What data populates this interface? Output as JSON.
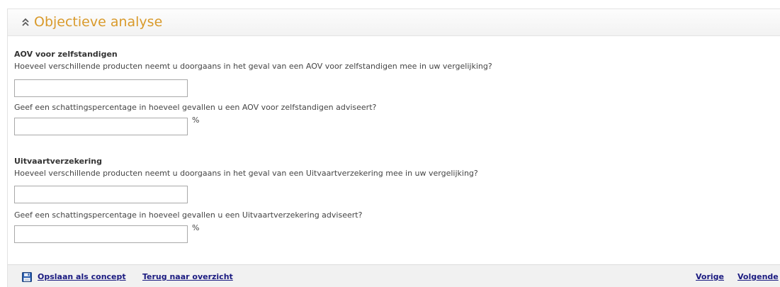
{
  "header": {
    "title": "Objectieve analyse",
    "collapse_icon": "chevron-double-up-icon"
  },
  "sections": [
    {
      "title": "AOV voor zelfstandigen",
      "q1": "Hoeveel verschillende producten neemt u doorgaans in het geval van een AOV voor zelfstandigen mee in uw vergelijking?",
      "q1_value": "",
      "q2": "Geef een schattingspercentage in hoeveel gevallen u een AOV voor zelfstandigen adviseert?",
      "q2_value": "",
      "q2_unit": "%"
    },
    {
      "title": "Uitvaartverzekering",
      "q1": "Hoeveel verschillende producten neemt u doorgaans in het geval van een Uitvaartverzekering mee in uw vergelijking?",
      "q1_value": "",
      "q2": "Geef een schattingspercentage in hoeveel gevallen u een Uitvaartverzekering adviseert?",
      "q2_value": "",
      "q2_unit": "%"
    }
  ],
  "footer": {
    "save_icon": "floppy-disk-icon",
    "save_label": "Opslaan als concept",
    "back_label": "Terug naar overzicht",
    "prev_label": "Vorige",
    "next_label": "Volgende"
  },
  "colors": {
    "title": "#d99a2b",
    "link": "#1a1a80",
    "footer_bg": "#f1f1f1"
  }
}
